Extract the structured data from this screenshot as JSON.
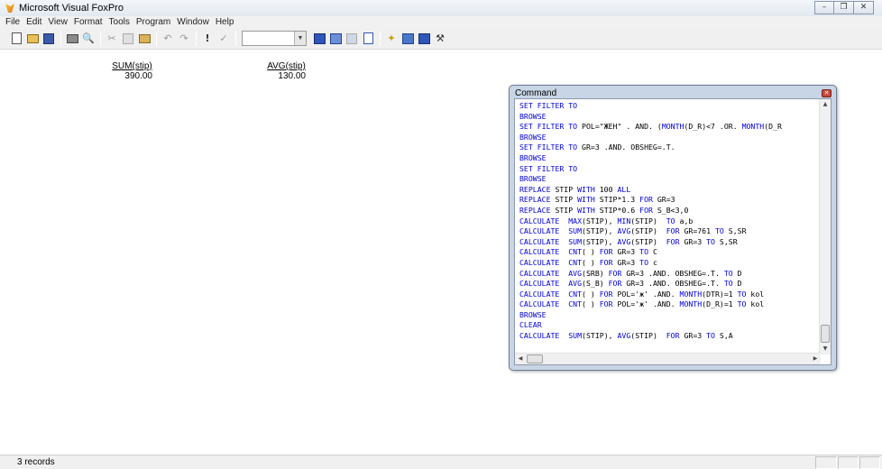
{
  "window": {
    "title": "Microsoft Visual FoxPro"
  },
  "menu": [
    "File",
    "Edit",
    "View",
    "Format",
    "Tools",
    "Program",
    "Window",
    "Help"
  ],
  "toolbar": {
    "combo_value": "",
    "icons": [
      "new-file-icon",
      "open-folder-icon",
      "save-icon",
      "print-icon",
      "print-preview-icon",
      "cut-icon",
      "copy-icon",
      "paste-icon",
      "undo-icon",
      "redo-icon",
      "run-icon",
      "modify-form-icon",
      "command-window-icon",
      "view-window-icon",
      "properties-icon",
      "report-icon",
      "wizard-icon",
      "project-icon",
      "form-designer-icon",
      "tools-icon"
    ]
  },
  "results": [
    {
      "label": "SUM(stip)",
      "value": "390.00"
    },
    {
      "label": "AVG(stip)",
      "value": "130.00"
    }
  ],
  "command_window": {
    "title": "Command",
    "lines": [
      "SET FILTER TO",
      "BROWSE",
      "SET FILTER TO POL=\"ЖЕН\" . AND. (MONTH(D_R)<7 .OR. MONTH(D_R",
      "BROWSE",
      "SET FILTER TO GR=3 .AND. OBSHEG=.T.",
      "BROWSE",
      "SET FILTER TO",
      "BROWSE",
      "REPLACE STIP WITH 100 ALL",
      "REPLACE STIP WITH STIP*1.3 FOR GR=3",
      "REPLACE STIP WITH STIP*0.6 FOR S_B<3,0",
      "CALCULATE  MAX(STIP), MIN(STIP)  TO a,b",
      "CALCULATE  SUM(STIP), AVG(STIP)  FOR GR=761 TO S,SR",
      "CALCULATE  SUM(STIP), AVG(STIP)  FOR GR=3 TO S,SR",
      "CALCULATE  CNT( ) FOR GR=3 TO C",
      "CALCULATE  CNT( ) FOR GR=3 TO c",
      "CALCULATE  AVG(SRB) FOR GR=3 .AND. OBSHEG=.T. TO D",
      "CALCULATE  AVG(S_B) FOR GR=3 .AND. OBSHEG=.T. TO D",
      "CALCULATE  CNT( ) FOR POL='ж' .AND. MONTH(DTR)=1 TO kol",
      "CALCULATE  CNT( ) FOR POL='ж' .AND. MONTH(D_R)=1 TO kol",
      "BROWSE",
      "CLEAR",
      "CALCULATE  SUM(STIP), AVG(STIP)  FOR GR=3 TO S,A"
    ]
  },
  "status": {
    "text": "3  records"
  }
}
